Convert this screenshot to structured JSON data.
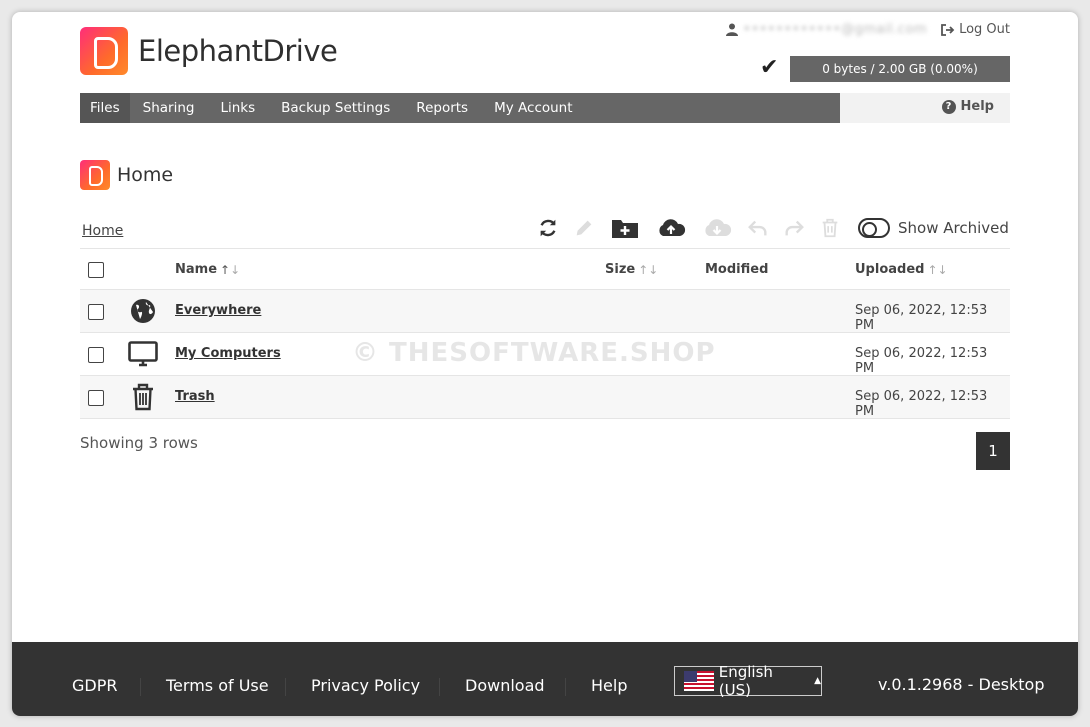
{
  "app": {
    "name": "ElephantDrive",
    "user_email": "••••••••••••@gmail.com",
    "logout_label": "Log Out",
    "quota_label": "0 bytes / 2.00 GB (0.00%)"
  },
  "nav": {
    "items": [
      {
        "label": "Files",
        "active": true
      },
      {
        "label": "Sharing",
        "active": false
      },
      {
        "label": "Links",
        "active": false
      },
      {
        "label": "Backup Settings",
        "active": false
      },
      {
        "label": "Reports",
        "active": false
      },
      {
        "label": "My Account",
        "active": false
      }
    ],
    "help_label": "Help"
  },
  "page": {
    "title": "Home",
    "breadcrumb": "Home",
    "show_archived_label": "Show Archived"
  },
  "table": {
    "columns": {
      "name": "Name",
      "size": "Size",
      "modified": "Modified",
      "uploaded": "Uploaded"
    },
    "rows": [
      {
        "name": "Everywhere",
        "icon": "globe-icon",
        "uploaded": "Sep 06, 2022, 12:53 PM"
      },
      {
        "name": "My Computers",
        "icon": "monitor-icon",
        "uploaded": "Sep 06, 2022, 12:53 PM"
      },
      {
        "name": "Trash",
        "icon": "trash-icon",
        "uploaded": "Sep 06, 2022, 12:53 PM"
      }
    ],
    "showing_label": "Showing 3 rows",
    "page_number": "1"
  },
  "watermark": "© THESOFTWARE.SHOP",
  "footer": {
    "links": [
      "GDPR",
      "Terms of Use",
      "Privacy Policy",
      "Download",
      "Help"
    ],
    "language": "English (US)",
    "version": "v.0.1.2968 - Desktop"
  },
  "colors": {
    "brand_pink": "#ff2d7a",
    "brand_orange": "#ff8a2b",
    "nav_bg": "#666666",
    "footer_bg": "#333333"
  }
}
